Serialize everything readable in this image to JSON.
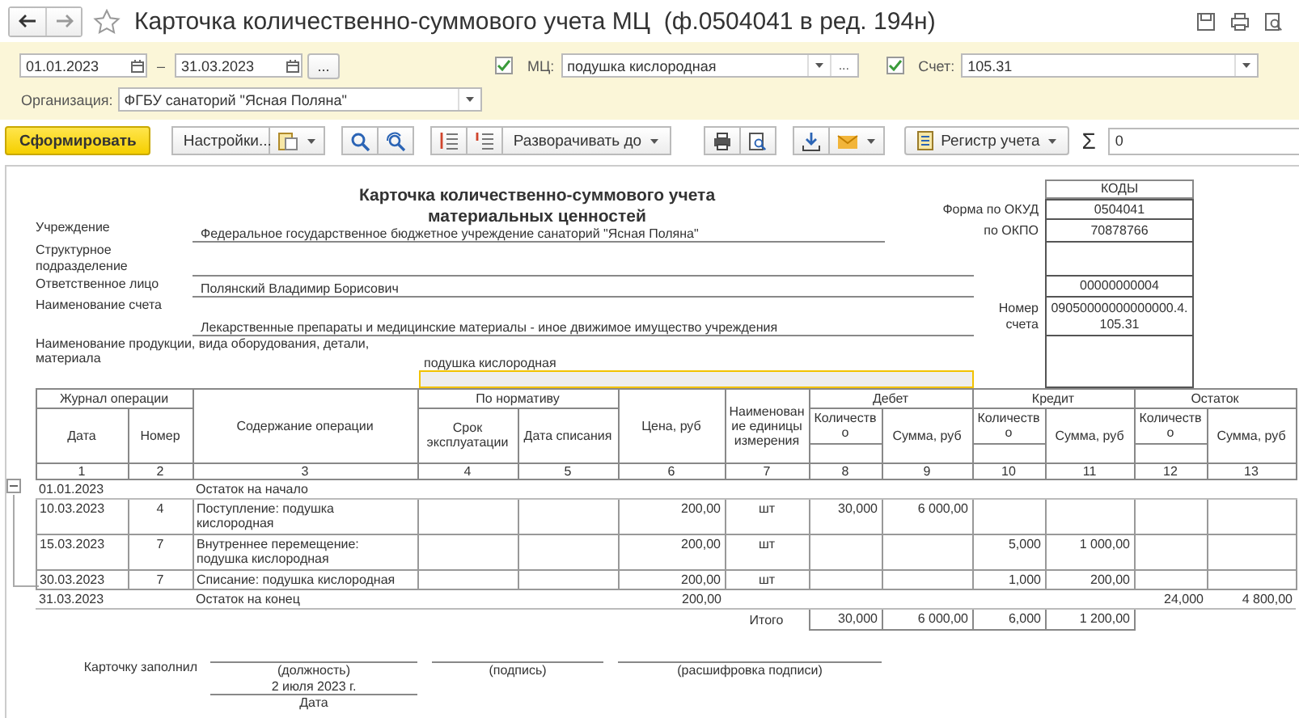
{
  "header": {
    "title": "Карточка количественно-суммового учета МЦ  (ф.0504041 в ред. 194н)"
  },
  "filters": {
    "period_from": "01.01.2023",
    "period_separator": "–",
    "period_to": "31.03.2023",
    "period_button": "...",
    "mc": {
      "label": "МЦ:",
      "checked": true,
      "value": "подушка кислородная",
      "select_button": "..."
    },
    "account": {
      "label": "Счет:",
      "checked": true,
      "value": "105.31"
    },
    "organization": {
      "label": "Организация:",
      "value": "ФГБУ санаторий \"Ясная Поляна\""
    }
  },
  "toolbar": {
    "generate_button": "Сформировать",
    "settings_button": "Настройки...",
    "expand_dropdown": "Разворачивать до",
    "register_button": "Регистр учета",
    "sum_sign": "Σ",
    "sum_value": "0"
  },
  "report": {
    "title": "Карточка количественно-суммового учета материальных ценностей",
    "codes_header": "КОДЫ",
    "okud_label": "Форма по ОКУД",
    "okud_code": "0504041",
    "okpo_label": "по ОКПО",
    "okpo_code": "70878766",
    "institution_label": "Учреждение",
    "institution": "Федеральное государственное бюджетное учреждение санаторий \"Ясная Поляна\"",
    "division_label": "Структурное подразделение",
    "responsible_label": "Ответственное лицо",
    "responsible": "Полянский Владимир Борисович",
    "responsible_code": "00000000004",
    "account_name_label": "Наименование счета",
    "account_name": "Лекарственные препараты и медицинские материалы - иное движимое имущество учреждения",
    "account_number_label": "Номер счета",
    "account_number_code": "09050000000000000.4.105.31",
    "product_label": "Наименование продукции, вида оборудования, детали, материала",
    "product": "подушка кислородная",
    "table": {
      "headers": {
        "journal": "Журнал операции",
        "date": "Дата",
        "number": "Номер",
        "content": "Содержание операции",
        "norm": "По нормативу",
        "service_life": "Срок эксплуатации",
        "writeoff_date": "Дата списания",
        "price": "Цена, руб",
        "unit": "Наименование единицы измерения",
        "debit": "Дебет",
        "credit": "Кредит",
        "balance": "Остаток",
        "quantity": [
          "Количество",
          "Количество",
          "Количество"
        ],
        "sum": [
          "Сумма, руб",
          "Сумма, руб",
          "Сумма, руб"
        ]
      },
      "column_numbers": [
        "1",
        "2",
        "3",
        "4",
        "5",
        "6",
        "7",
        "8",
        "9",
        "10",
        "11",
        "12",
        "13"
      ],
      "operations_expanded": true,
      "rows": [
        {
          "kind": "balance",
          "date": "01.01.2023",
          "content": "Остаток на начало"
        },
        {
          "kind": "operation",
          "date": "10.03.2023",
          "number": "4",
          "content": "Поступление: подушка кислородная",
          "price": "200,00",
          "unit": "шт",
          "debit_qty": "30,000",
          "debit_sum": "6 000,00"
        },
        {
          "kind": "operation",
          "date": "15.03.2023",
          "number": "7",
          "content": "Внутреннее перемещение: подушка кислородная",
          "price": "200,00",
          "unit": "шт",
          "credit_qty": "5,000",
          "credit_sum": "1 000,00"
        },
        {
          "kind": "operation",
          "date": "30.03.2023",
          "number": "7",
          "content": "Списание: подушка кислородная",
          "price": "200,00",
          "unit": "шт",
          "credit_qty": "1,000",
          "credit_sum": "200,00"
        },
        {
          "kind": "balance",
          "date": "31.03.2023",
          "content": "Остаток на конец",
          "price": "200,00",
          "balance_qty": "24,000",
          "balance_sum": "4 800,00"
        }
      ],
      "total": {
        "label": "Итого",
        "debit_qty": "30,000",
        "debit_sum": "6 000,00",
        "credit_qty": "6,000",
        "credit_sum": "1 200,00"
      }
    },
    "signature": {
      "label": "Карточку заполнил",
      "position": "(должность)",
      "signature": "(подпись)",
      "decoding": "(расшифровка подписи)",
      "date_value": "2 июля 2023 г.",
      "date_caption": "Дата"
    }
  }
}
